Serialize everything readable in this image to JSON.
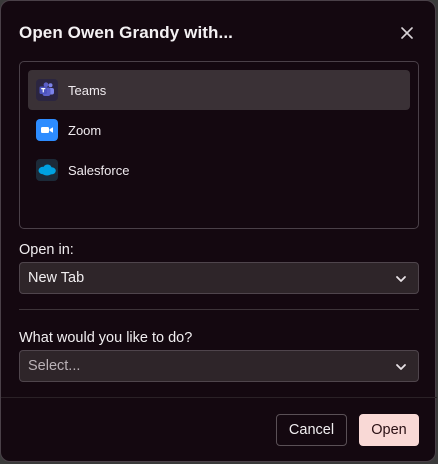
{
  "dialog": {
    "title": "Open Owen Grandy with..."
  },
  "apps": [
    {
      "label": "Teams",
      "icon": "teams-icon",
      "selected": true
    },
    {
      "label": "Zoom",
      "icon": "zoom-icon",
      "selected": false
    },
    {
      "label": "Salesforce",
      "icon": "salesforce-icon",
      "selected": false
    }
  ],
  "open_in": {
    "label": "Open in:",
    "value": "New Tab"
  },
  "action": {
    "label": "What would you like to do?",
    "placeholder": "Select..."
  },
  "buttons": {
    "cancel": "Cancel",
    "open": "Open"
  },
  "colors": {
    "background": "#140810",
    "selected_row": "#3a3136",
    "primary_button": "#f9d9d6",
    "teams": "#5b5fc7",
    "zoom": "#2d8cff",
    "salesforce": "#00a1e0"
  }
}
